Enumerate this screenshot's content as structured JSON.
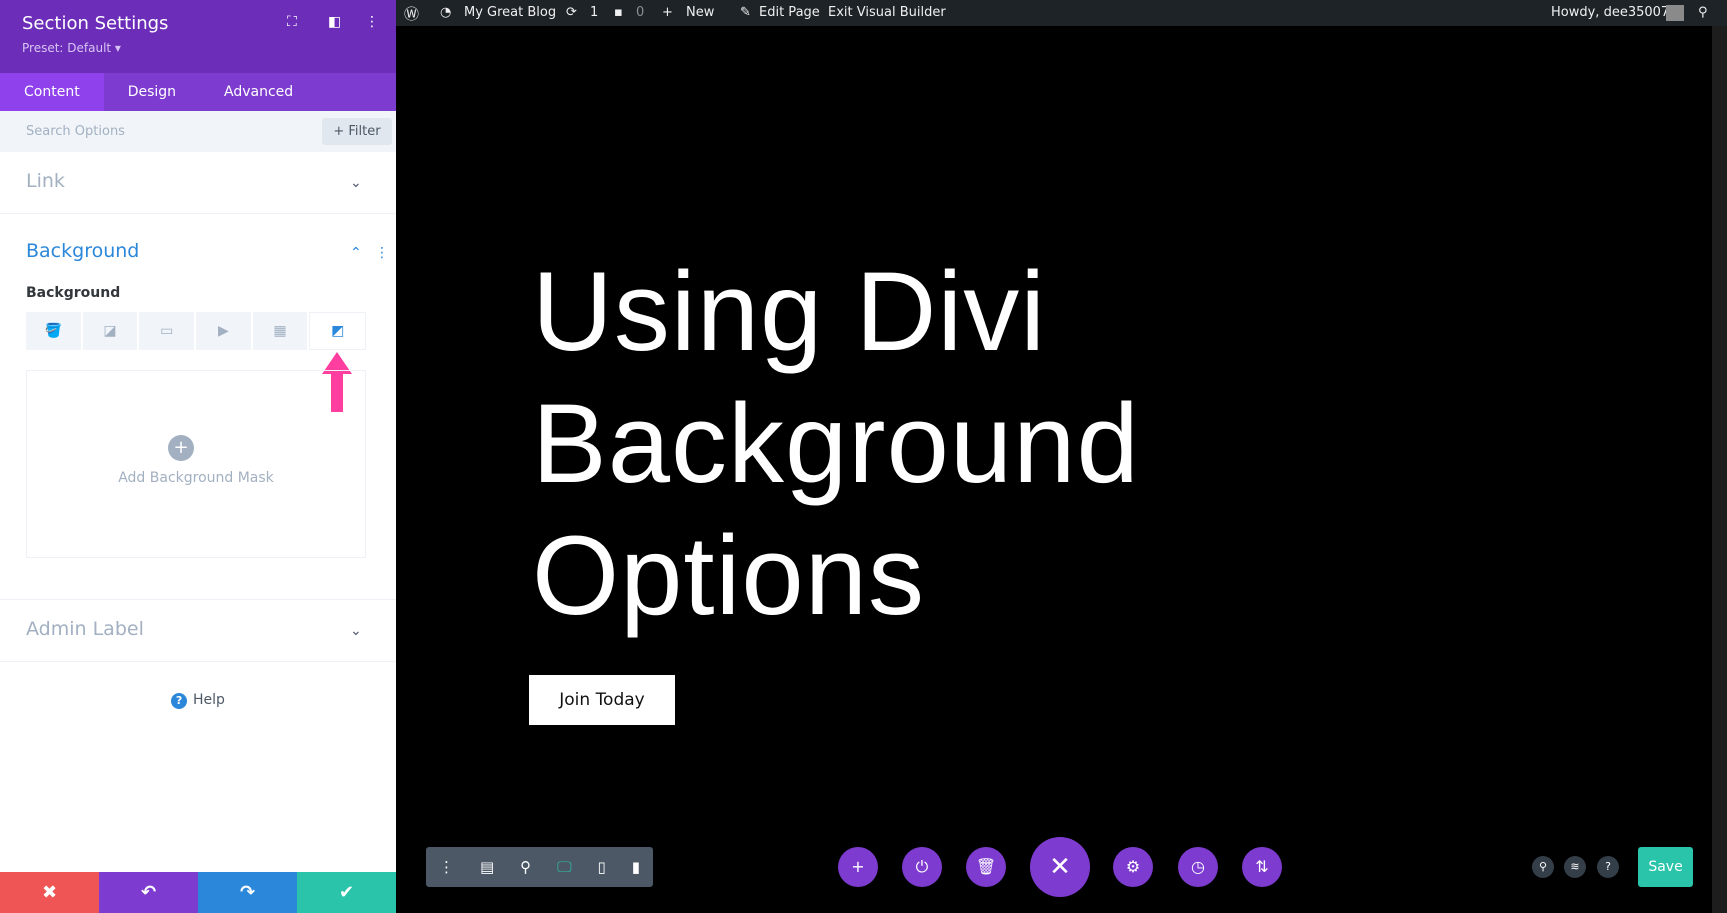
{
  "panel": {
    "title": "Section Settings",
    "preset": "Preset: Default ▾",
    "tabs": [
      "Content",
      "Design",
      "Advanced"
    ],
    "search_placeholder": "Search Options",
    "filter_label": "+ Filter",
    "sections": {
      "link": "Link",
      "background": "Background",
      "admin_label": "Admin Label"
    },
    "background_label": "Background",
    "add_mask": "Add Background Mask",
    "help": "Help",
    "footer_colors": {
      "cancel": "#ef5555",
      "undo": "#7e3bd0",
      "redo": "#2b87da",
      "save": "#29c4a9"
    }
  },
  "adminbar": {
    "site": "My Great Blog",
    "updates": "1",
    "comments": "0",
    "new": "New",
    "edit": "Edit Page",
    "exit": "Exit Visual Builder",
    "howdy": "Howdy, dee35007"
  },
  "page": {
    "headline": [
      "Using Divi",
      "Background",
      "Options"
    ],
    "button": "Join Today"
  },
  "builder": {
    "save": "Save"
  }
}
